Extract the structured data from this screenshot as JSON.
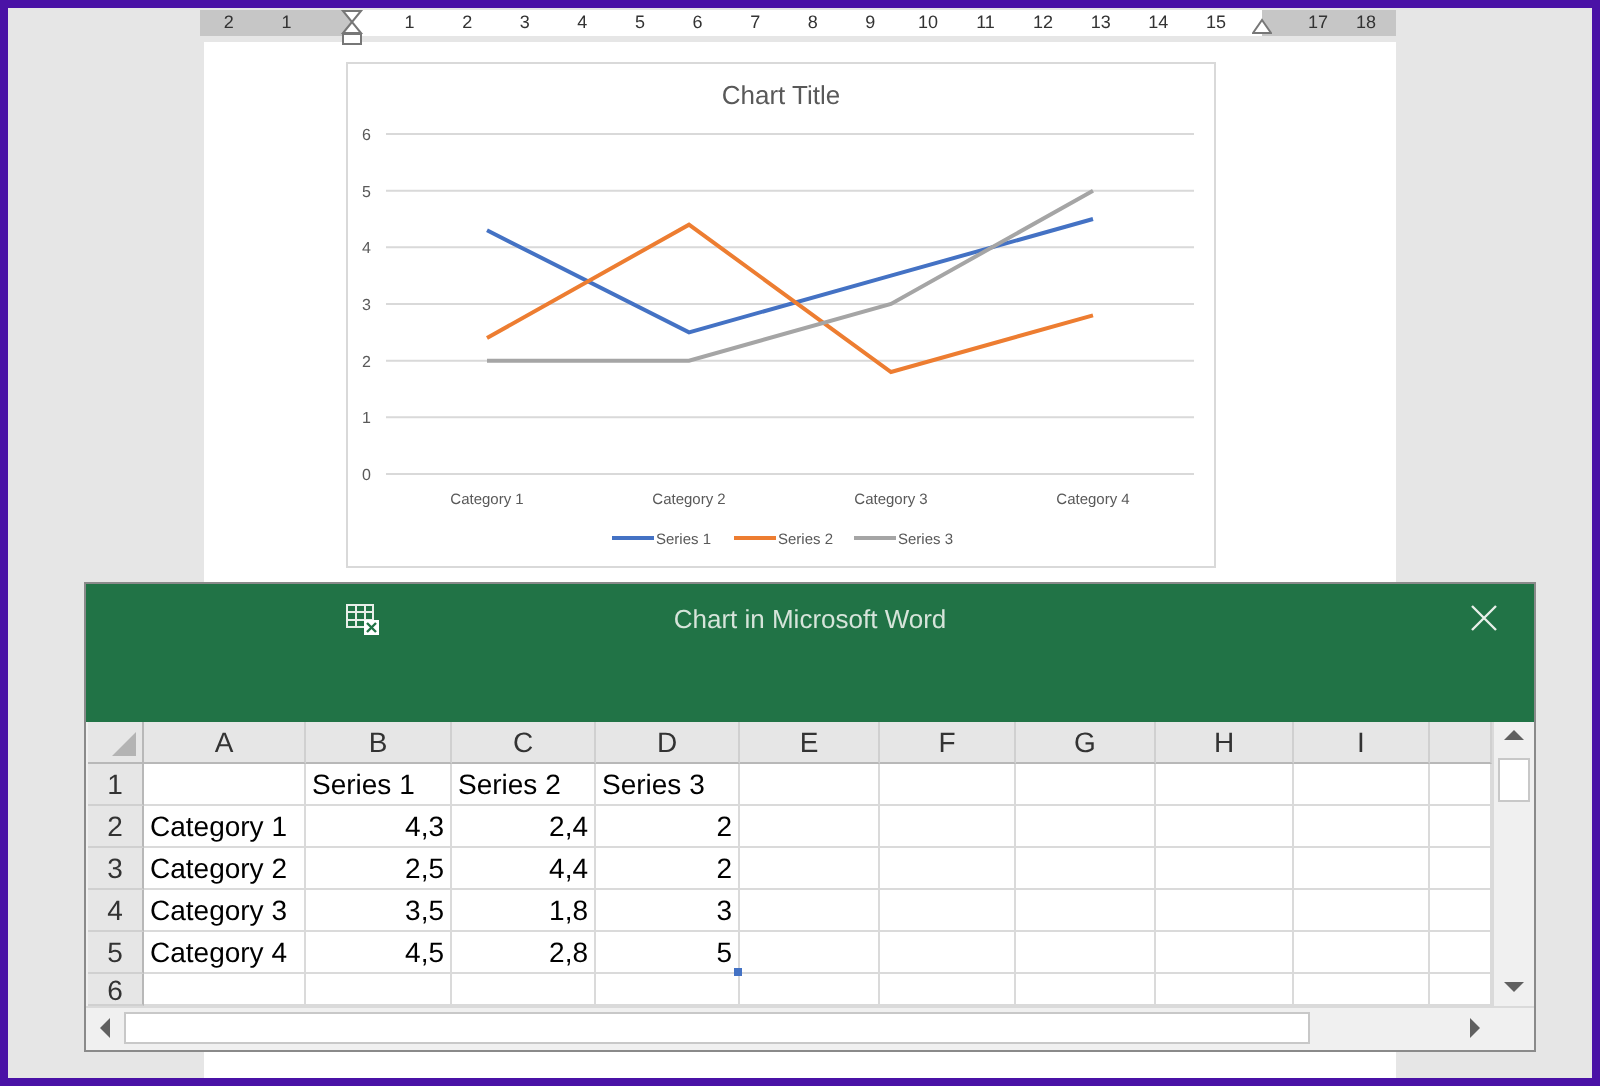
{
  "ruler": {
    "left_labels": [
      "2",
      "1"
    ],
    "labels": [
      "1",
      "2",
      "3",
      "4",
      "5",
      "6",
      "7",
      "8",
      "9",
      "10",
      "11",
      "12",
      "13",
      "14",
      "15"
    ],
    "right_labels": [
      "17",
      "18"
    ]
  },
  "chart": {
    "chart_data": {
      "type": "line",
      "title": "Chart Title",
      "categories": [
        "Category 1",
        "Category 2",
        "Category 3",
        "Category 4"
      ],
      "series": [
        {
          "name": "Series 1",
          "color": "#4472c4",
          "values": [
            4.3,
            2.5,
            3.5,
            4.5
          ]
        },
        {
          "name": "Series 2",
          "color": "#ed7d31",
          "values": [
            2.4,
            4.4,
            1.8,
            2.8
          ]
        },
        {
          "name": "Series 3",
          "color": "#a5a5a5",
          "values": [
            2,
            2,
            3,
            5
          ]
        }
      ],
      "ylim": [
        0,
        6
      ],
      "yticks": [
        0,
        1,
        2,
        3,
        4,
        5,
        6
      ],
      "grid": true,
      "legend": true
    }
  },
  "data_window": {
    "title": "Chart in Microsoft Word",
    "columns": [
      "A",
      "B",
      "C",
      "D",
      "E",
      "F",
      "G",
      "H",
      "I"
    ],
    "header_row": {
      "number": "1",
      "cells": [
        "Series 1",
        "Series 2",
        "Series 3"
      ]
    },
    "rows": [
      {
        "number": "2",
        "label": "Category 1",
        "values": [
          "4,3",
          "2,4",
          "2"
        ]
      },
      {
        "number": "3",
        "label": "Category 2",
        "values": [
          "2,5",
          "4,4",
          "2"
        ]
      },
      {
        "number": "4",
        "label": "Category 3",
        "values": [
          "3,5",
          "1,8",
          "3"
        ]
      },
      {
        "number": "5",
        "label": "Category 4",
        "values": [
          "4,5",
          "2,8",
          "5"
        ]
      }
    ],
    "last_row": {
      "number": "6"
    }
  }
}
